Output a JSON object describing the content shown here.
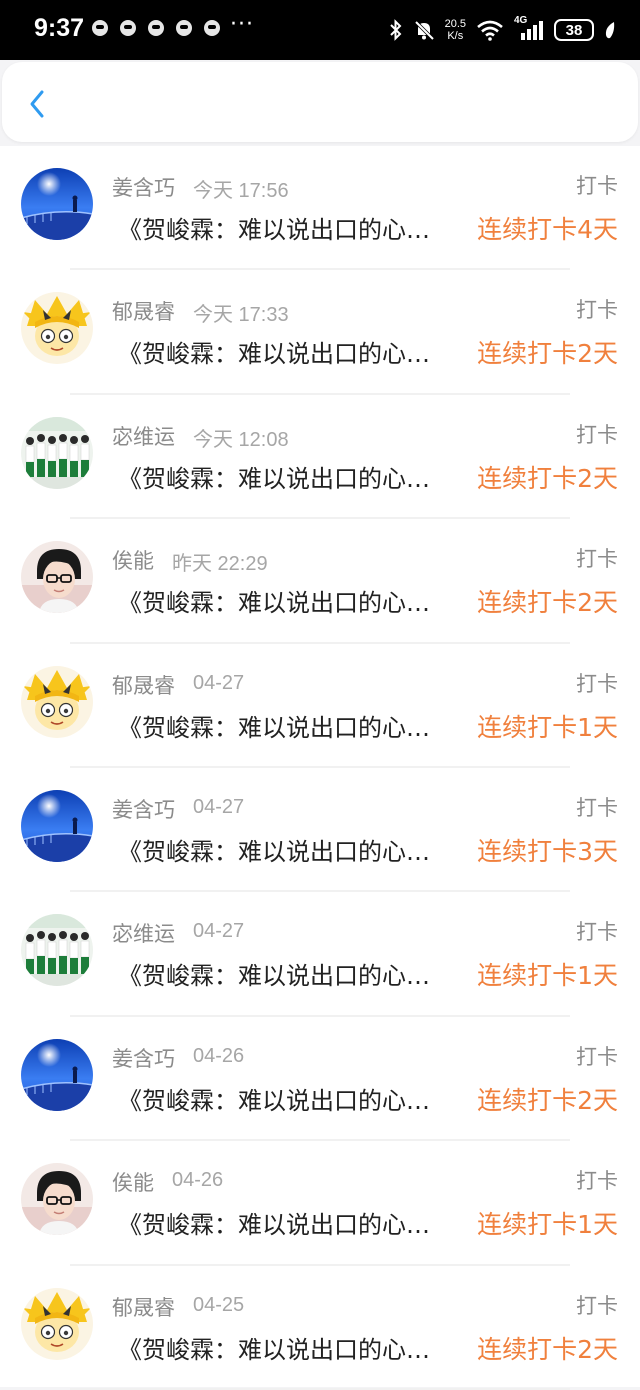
{
  "status_bar": {
    "time": "9:37",
    "more": "···",
    "net_speed_value": "20.5",
    "net_speed_unit": "K/s",
    "network_type": "4G",
    "battery": "38"
  },
  "header": {
    "back_icon": "chevron-left-icon"
  },
  "colors": {
    "accent_blue": "#2f9bf0",
    "streak_orange": "#f0803d"
  },
  "checkins": [
    {
      "user": "姜含巧",
      "time": "今天 17:56",
      "avatar": "sky",
      "tag": "打卡",
      "title": "《贺峻霖：难以说出口的心事》",
      "streak": "连续打卡4天"
    },
    {
      "user": "郁晟睿",
      "time": "今天 17:33",
      "avatar": "cartoon",
      "tag": "打卡",
      "title": "《贺峻霖：难以说出口的心事》",
      "streak": "连续打卡2天"
    },
    {
      "user": "宓维运",
      "time": "今天 12:08",
      "avatar": "group",
      "tag": "打卡",
      "title": "《贺峻霖：难以说出口的心事》",
      "streak": "连续打卡2天"
    },
    {
      "user": "俟能",
      "time": "昨天 22:29",
      "avatar": "portrait",
      "tag": "打卡",
      "title": "《贺峻霖：难以说出口的心事》",
      "streak": "连续打卡2天"
    },
    {
      "user": "郁晟睿",
      "time": "04-27",
      "avatar": "cartoon",
      "tag": "打卡",
      "title": "《贺峻霖：难以说出口的心事》",
      "streak": "连续打卡1天"
    },
    {
      "user": "姜含巧",
      "time": "04-27",
      "avatar": "sky",
      "tag": "打卡",
      "title": "《贺峻霖：难以说出口的心事》",
      "streak": "连续打卡3天"
    },
    {
      "user": "宓维运",
      "time": "04-27",
      "avatar": "group",
      "tag": "打卡",
      "title": "《贺峻霖：难以说出口的心事》",
      "streak": "连续打卡1天"
    },
    {
      "user": "姜含巧",
      "time": "04-26",
      "avatar": "sky",
      "tag": "打卡",
      "title": "《贺峻霖：难以说出口的心事》",
      "streak": "连续打卡2天"
    },
    {
      "user": "俟能",
      "time": "04-26",
      "avatar": "portrait",
      "tag": "打卡",
      "title": "《贺峻霖：难以说出口的心事》",
      "streak": "连续打卡1天"
    },
    {
      "user": "郁晟睿",
      "time": "04-25",
      "avatar": "cartoon",
      "tag": "打卡",
      "title": "《贺峻霖：难以说出口的心事》",
      "streak": "连续打卡2天"
    }
  ]
}
